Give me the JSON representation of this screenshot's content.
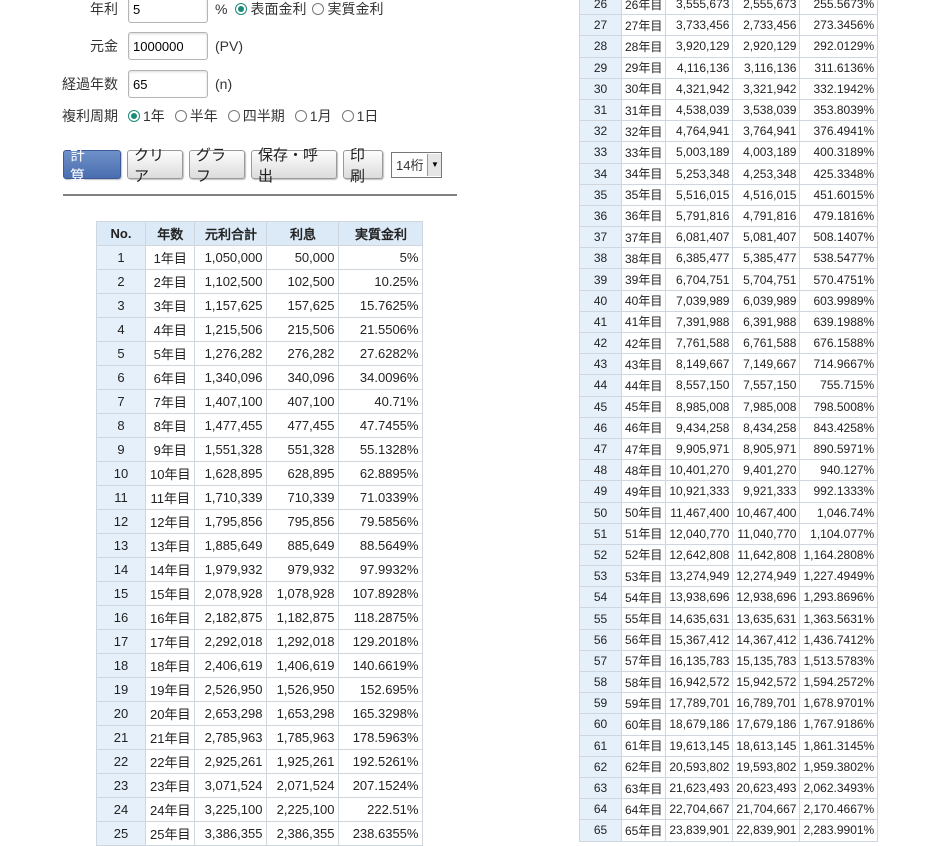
{
  "form": {
    "rate": {
      "label": "年利",
      "value": "5",
      "suffix": "%",
      "opt_nominal": "表面金利",
      "opt_effective": "実質金利",
      "selected": "表面金利"
    },
    "principal": {
      "label": "元金",
      "value": "1000000",
      "suffix": "(PV)"
    },
    "years": {
      "label": "経過年数",
      "value": "65",
      "suffix": "(n)"
    },
    "period": {
      "label": "複利周期",
      "options": [
        "1年",
        "半年",
        "四半期",
        "1月",
        "1日"
      ],
      "selected": "1年"
    }
  },
  "buttons": {
    "calc": "計 算",
    "clear": "クリア",
    "graph": "グラフ",
    "save": "保存・呼出",
    "print": "印刷"
  },
  "digits": {
    "value": "14桁"
  },
  "table": {
    "headers": [
      "No.",
      "年数",
      "元利合計",
      "利息",
      "実質金利"
    ],
    "rows": [
      [
        "1",
        "1年目",
        "1,050,000",
        "50,000",
        "5%"
      ],
      [
        "2",
        "2年目",
        "1,102,500",
        "102,500",
        "10.25%"
      ],
      [
        "3",
        "3年目",
        "1,157,625",
        "157,625",
        "15.7625%"
      ],
      [
        "4",
        "4年目",
        "1,215,506",
        "215,506",
        "21.5506%"
      ],
      [
        "5",
        "5年目",
        "1,276,282",
        "276,282",
        "27.6282%"
      ],
      [
        "6",
        "6年目",
        "1,340,096",
        "340,096",
        "34.0096%"
      ],
      [
        "7",
        "7年目",
        "1,407,100",
        "407,100",
        "40.71%"
      ],
      [
        "8",
        "8年目",
        "1,477,455",
        "477,455",
        "47.7455%"
      ],
      [
        "9",
        "9年目",
        "1,551,328",
        "551,328",
        "55.1328%"
      ],
      [
        "10",
        "10年目",
        "1,628,895",
        "628,895",
        "62.8895%"
      ],
      [
        "11",
        "11年目",
        "1,710,339",
        "710,339",
        "71.0339%"
      ],
      [
        "12",
        "12年目",
        "1,795,856",
        "795,856",
        "79.5856%"
      ],
      [
        "13",
        "13年目",
        "1,885,649",
        "885,649",
        "88.5649%"
      ],
      [
        "14",
        "14年目",
        "1,979,932",
        "979,932",
        "97.9932%"
      ],
      [
        "15",
        "15年目",
        "2,078,928",
        "1,078,928",
        "107.8928%"
      ],
      [
        "16",
        "16年目",
        "2,182,875",
        "1,182,875",
        "118.2875%"
      ],
      [
        "17",
        "17年目",
        "2,292,018",
        "1,292,018",
        "129.2018%"
      ],
      [
        "18",
        "18年目",
        "2,406,619",
        "1,406,619",
        "140.6619%"
      ],
      [
        "19",
        "19年目",
        "2,526,950",
        "1,526,950",
        "152.695%"
      ],
      [
        "20",
        "20年目",
        "2,653,298",
        "1,653,298",
        "165.3298%"
      ],
      [
        "21",
        "21年目",
        "2,785,963",
        "1,785,963",
        "178.5963%"
      ],
      [
        "22",
        "22年目",
        "2,925,261",
        "1,925,261",
        "192.5261%"
      ],
      [
        "23",
        "23年目",
        "3,071,524",
        "2,071,524",
        "207.1524%"
      ],
      [
        "24",
        "24年目",
        "3,225,100",
        "2,225,100",
        "222.51%"
      ],
      [
        "25",
        "25年目",
        "3,386,355",
        "2,386,355",
        "238.6355%"
      ]
    ],
    "rows_right": [
      [
        "26",
        "26年目",
        "3,555,673",
        "2,555,673",
        "255.5673%"
      ],
      [
        "27",
        "27年目",
        "3,733,456",
        "2,733,456",
        "273.3456%"
      ],
      [
        "28",
        "28年目",
        "3,920,129",
        "2,920,129",
        "292.0129%"
      ],
      [
        "29",
        "29年目",
        "4,116,136",
        "3,116,136",
        "311.6136%"
      ],
      [
        "30",
        "30年目",
        "4,321,942",
        "3,321,942",
        "332.1942%"
      ],
      [
        "31",
        "31年目",
        "4,538,039",
        "3,538,039",
        "353.8039%"
      ],
      [
        "32",
        "32年目",
        "4,764,941",
        "3,764,941",
        "376.4941%"
      ],
      [
        "33",
        "33年目",
        "5,003,189",
        "4,003,189",
        "400.3189%"
      ],
      [
        "34",
        "34年目",
        "5,253,348",
        "4,253,348",
        "425.3348%"
      ],
      [
        "35",
        "35年目",
        "5,516,015",
        "4,516,015",
        "451.6015%"
      ],
      [
        "36",
        "36年目",
        "5,791,816",
        "4,791,816",
        "479.1816%"
      ],
      [
        "37",
        "37年目",
        "6,081,407",
        "5,081,407",
        "508.1407%"
      ],
      [
        "38",
        "38年目",
        "6,385,477",
        "5,385,477",
        "538.5477%"
      ],
      [
        "39",
        "39年目",
        "6,704,751",
        "5,704,751",
        "570.4751%"
      ],
      [
        "40",
        "40年目",
        "7,039,989",
        "6,039,989",
        "603.9989%"
      ],
      [
        "41",
        "41年目",
        "7,391,988",
        "6,391,988",
        "639.1988%"
      ],
      [
        "42",
        "42年目",
        "7,761,588",
        "6,761,588",
        "676.1588%"
      ],
      [
        "43",
        "43年目",
        "8,149,667",
        "7,149,667",
        "714.9667%"
      ],
      [
        "44",
        "44年目",
        "8,557,150",
        "7,557,150",
        "755.715%"
      ],
      [
        "45",
        "45年目",
        "8,985,008",
        "7,985,008",
        "798.5008%"
      ],
      [
        "46",
        "46年目",
        "9,434,258",
        "8,434,258",
        "843.4258%"
      ],
      [
        "47",
        "47年目",
        "9,905,971",
        "8,905,971",
        "890.5971%"
      ],
      [
        "48",
        "48年目",
        "10,401,270",
        "9,401,270",
        "940.127%"
      ],
      [
        "49",
        "49年目",
        "10,921,333",
        "9,921,333",
        "992.1333%"
      ],
      [
        "50",
        "50年目",
        "11,467,400",
        "10,467,400",
        "1,046.74%"
      ],
      [
        "51",
        "51年目",
        "12,040,770",
        "11,040,770",
        "1,104.077%"
      ],
      [
        "52",
        "52年目",
        "12,642,808",
        "11,642,808",
        "1,164.2808%"
      ],
      [
        "53",
        "53年目",
        "13,274,949",
        "12,274,949",
        "1,227.4949%"
      ],
      [
        "54",
        "54年目",
        "13,938,696",
        "12,938,696",
        "1,293.8696%"
      ],
      [
        "55",
        "55年目",
        "14,635,631",
        "13,635,631",
        "1,363.5631%"
      ],
      [
        "56",
        "56年目",
        "15,367,412",
        "14,367,412",
        "1,436.7412%"
      ],
      [
        "57",
        "57年目",
        "16,135,783",
        "15,135,783",
        "1,513.5783%"
      ],
      [
        "58",
        "58年目",
        "16,942,572",
        "15,942,572",
        "1,594.2572%"
      ],
      [
        "59",
        "59年目",
        "17,789,701",
        "16,789,701",
        "1,678.9701%"
      ],
      [
        "60",
        "60年目",
        "18,679,186",
        "17,679,186",
        "1,767.9186%"
      ],
      [
        "61",
        "61年目",
        "19,613,145",
        "18,613,145",
        "1,861.3145%"
      ],
      [
        "62",
        "62年目",
        "20,593,802",
        "19,593,802",
        "1,959.3802%"
      ],
      [
        "63",
        "63年目",
        "21,623,493",
        "20,623,493",
        "2,062.3493%"
      ],
      [
        "64",
        "64年目",
        "22,704,667",
        "21,704,667",
        "2,170.4667%"
      ],
      [
        "65",
        "65年目",
        "23,839,901",
        "22,839,901",
        "2,283.9901%"
      ]
    ]
  }
}
